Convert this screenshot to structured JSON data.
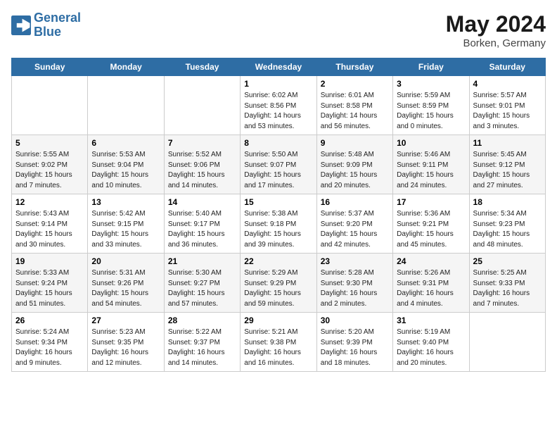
{
  "header": {
    "logo_line1": "General",
    "logo_line2": "Blue",
    "main_title": "May 2024",
    "subtitle": "Borken, Germany"
  },
  "days_of_week": [
    "Sunday",
    "Monday",
    "Tuesday",
    "Wednesday",
    "Thursday",
    "Friday",
    "Saturday"
  ],
  "weeks": [
    [
      {
        "day": "",
        "info": ""
      },
      {
        "day": "",
        "info": ""
      },
      {
        "day": "",
        "info": ""
      },
      {
        "day": "1",
        "info": "Sunrise: 6:02 AM\nSunset: 8:56 PM\nDaylight: 14 hours\nand 53 minutes."
      },
      {
        "day": "2",
        "info": "Sunrise: 6:01 AM\nSunset: 8:58 PM\nDaylight: 14 hours\nand 56 minutes."
      },
      {
        "day": "3",
        "info": "Sunrise: 5:59 AM\nSunset: 8:59 PM\nDaylight: 15 hours\nand 0 minutes."
      },
      {
        "day": "4",
        "info": "Sunrise: 5:57 AM\nSunset: 9:01 PM\nDaylight: 15 hours\nand 3 minutes."
      }
    ],
    [
      {
        "day": "5",
        "info": "Sunrise: 5:55 AM\nSunset: 9:02 PM\nDaylight: 15 hours\nand 7 minutes."
      },
      {
        "day": "6",
        "info": "Sunrise: 5:53 AM\nSunset: 9:04 PM\nDaylight: 15 hours\nand 10 minutes."
      },
      {
        "day": "7",
        "info": "Sunrise: 5:52 AM\nSunset: 9:06 PM\nDaylight: 15 hours\nand 14 minutes."
      },
      {
        "day": "8",
        "info": "Sunrise: 5:50 AM\nSunset: 9:07 PM\nDaylight: 15 hours\nand 17 minutes."
      },
      {
        "day": "9",
        "info": "Sunrise: 5:48 AM\nSunset: 9:09 PM\nDaylight: 15 hours\nand 20 minutes."
      },
      {
        "day": "10",
        "info": "Sunrise: 5:46 AM\nSunset: 9:11 PM\nDaylight: 15 hours\nand 24 minutes."
      },
      {
        "day": "11",
        "info": "Sunrise: 5:45 AM\nSunset: 9:12 PM\nDaylight: 15 hours\nand 27 minutes."
      }
    ],
    [
      {
        "day": "12",
        "info": "Sunrise: 5:43 AM\nSunset: 9:14 PM\nDaylight: 15 hours\nand 30 minutes."
      },
      {
        "day": "13",
        "info": "Sunrise: 5:42 AM\nSunset: 9:15 PM\nDaylight: 15 hours\nand 33 minutes."
      },
      {
        "day": "14",
        "info": "Sunrise: 5:40 AM\nSunset: 9:17 PM\nDaylight: 15 hours\nand 36 minutes."
      },
      {
        "day": "15",
        "info": "Sunrise: 5:38 AM\nSunset: 9:18 PM\nDaylight: 15 hours\nand 39 minutes."
      },
      {
        "day": "16",
        "info": "Sunrise: 5:37 AM\nSunset: 9:20 PM\nDaylight: 15 hours\nand 42 minutes."
      },
      {
        "day": "17",
        "info": "Sunrise: 5:36 AM\nSunset: 9:21 PM\nDaylight: 15 hours\nand 45 minutes."
      },
      {
        "day": "18",
        "info": "Sunrise: 5:34 AM\nSunset: 9:23 PM\nDaylight: 15 hours\nand 48 minutes."
      }
    ],
    [
      {
        "day": "19",
        "info": "Sunrise: 5:33 AM\nSunset: 9:24 PM\nDaylight: 15 hours\nand 51 minutes."
      },
      {
        "day": "20",
        "info": "Sunrise: 5:31 AM\nSunset: 9:26 PM\nDaylight: 15 hours\nand 54 minutes."
      },
      {
        "day": "21",
        "info": "Sunrise: 5:30 AM\nSunset: 9:27 PM\nDaylight: 15 hours\nand 57 minutes."
      },
      {
        "day": "22",
        "info": "Sunrise: 5:29 AM\nSunset: 9:29 PM\nDaylight: 15 hours\nand 59 minutes."
      },
      {
        "day": "23",
        "info": "Sunrise: 5:28 AM\nSunset: 9:30 PM\nDaylight: 16 hours\nand 2 minutes."
      },
      {
        "day": "24",
        "info": "Sunrise: 5:26 AM\nSunset: 9:31 PM\nDaylight: 16 hours\nand 4 minutes."
      },
      {
        "day": "25",
        "info": "Sunrise: 5:25 AM\nSunset: 9:33 PM\nDaylight: 16 hours\nand 7 minutes."
      }
    ],
    [
      {
        "day": "26",
        "info": "Sunrise: 5:24 AM\nSunset: 9:34 PM\nDaylight: 16 hours\nand 9 minutes."
      },
      {
        "day": "27",
        "info": "Sunrise: 5:23 AM\nSunset: 9:35 PM\nDaylight: 16 hours\nand 12 minutes."
      },
      {
        "day": "28",
        "info": "Sunrise: 5:22 AM\nSunset: 9:37 PM\nDaylight: 16 hours\nand 14 minutes."
      },
      {
        "day": "29",
        "info": "Sunrise: 5:21 AM\nSunset: 9:38 PM\nDaylight: 16 hours\nand 16 minutes."
      },
      {
        "day": "30",
        "info": "Sunrise: 5:20 AM\nSunset: 9:39 PM\nDaylight: 16 hours\nand 18 minutes."
      },
      {
        "day": "31",
        "info": "Sunrise: 5:19 AM\nSunset: 9:40 PM\nDaylight: 16 hours\nand 20 minutes."
      },
      {
        "day": "",
        "info": ""
      }
    ]
  ]
}
